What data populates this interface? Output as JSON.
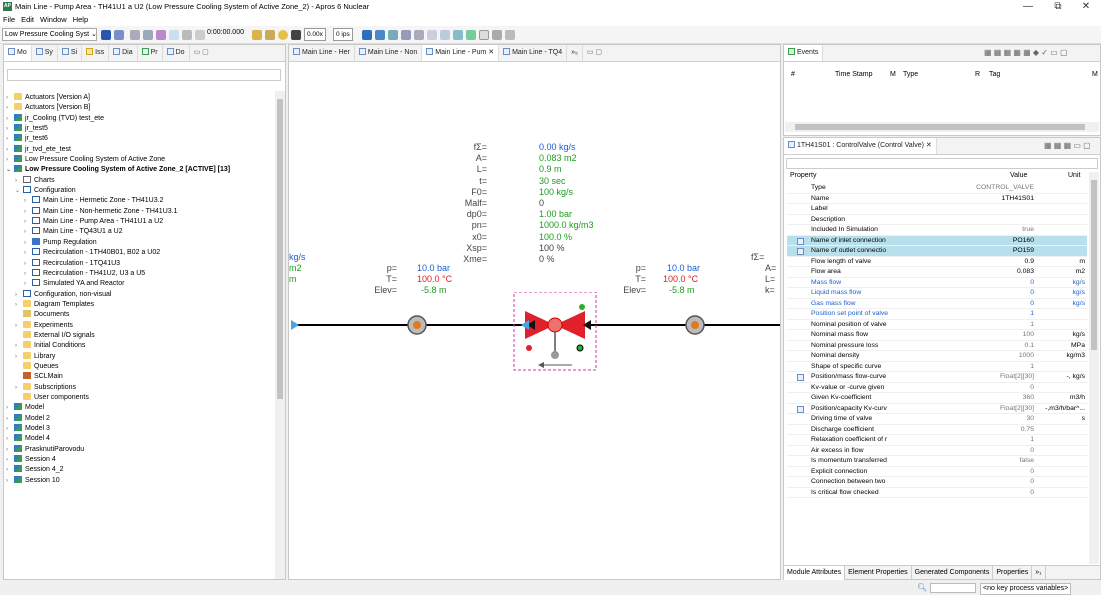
{
  "window": {
    "title": "Main Line - Pump Area - TH41U1 a U2 (Low Pressure Cooling System of Active Zone_2) - Apros 6 Nuclear",
    "icon": "apros-app-icon",
    "minimize": "—",
    "maximize": "⧉",
    "close": "✕"
  },
  "menu": [
    "File",
    "Edit",
    "Window",
    "Help"
  ],
  "toolbar": {
    "model_combo": "Low Pressure Cooling Syst",
    "sim_time": "0:00:00.000",
    "speed": "0.00x",
    "ips": "0 ips"
  },
  "left_tabs": [
    "Mo",
    "Sy",
    "Si",
    "Iss",
    "Dia",
    "Pr",
    "Do"
  ],
  "tree": [
    {
      "label": "Actuators [Version A]",
      "icon": "folder",
      "depth": 0,
      "arrow": "›"
    },
    {
      "label": "Actuators [Version B]",
      "icon": "folder",
      "depth": 0,
      "arrow": "›"
    },
    {
      "label": "jr_Cooling (TVD) test_ete",
      "icon": "proj",
      "depth": 0,
      "arrow": "›"
    },
    {
      "label": "jr_test5",
      "icon": "proj",
      "depth": 0,
      "arrow": "›"
    },
    {
      "label": "jr_test6",
      "icon": "proj",
      "depth": 0,
      "arrow": "›"
    },
    {
      "label": "jr_tvd_ete_test",
      "icon": "proj",
      "depth": 0,
      "arrow": "›"
    },
    {
      "label": "Low Pressure Cooling System of Active Zone",
      "icon": "proj",
      "depth": 0,
      "arrow": "›"
    },
    {
      "label": "Low Pressure Cooling System of Active Zone_2 [ACTIVE] [13]",
      "icon": "proj",
      "depth": 0,
      "arrow": "⌄",
      "bold": true
    },
    {
      "label": "Charts",
      "icon": "chart",
      "depth": 1,
      "arrow": "›"
    },
    {
      "label": "Configuration",
      "icon": "diag",
      "depth": 1,
      "arrow": "⌄"
    },
    {
      "label": "Main Line - Hermetic Zone - TH41U3.2",
      "icon": "diag",
      "depth": 2,
      "arrow": "›"
    },
    {
      "label": "Main Line - Non-hermetic Zone - TH41U3.1",
      "icon": "diag",
      "depth": 2,
      "arrow": "›"
    },
    {
      "label": "Main Line - Pump Area - TH41U1 a U2",
      "icon": "diag",
      "depth": 2,
      "arrow": "›"
    },
    {
      "label": "Main Line - TQ43U1 a U2",
      "icon": "diag",
      "depth": 2,
      "arrow": "›"
    },
    {
      "label": "Pump Regulation",
      "icon": "pump",
      "depth": 2,
      "arrow": "›"
    },
    {
      "label": "Recirculation - 1TH40B01, B02 a U02",
      "icon": "diag",
      "depth": 2,
      "arrow": "›"
    },
    {
      "label": "Recirculation - 1TQ41U3",
      "icon": "diag",
      "depth": 2,
      "arrow": "›"
    },
    {
      "label": "Recirculation - TH41U2, U3 a U5",
      "icon": "diag",
      "depth": 2,
      "arrow": "›"
    },
    {
      "label": "Simulated YA and Reactor",
      "icon": "diag",
      "depth": 2,
      "arrow": "›"
    },
    {
      "label": "Configuration, non-visual",
      "icon": "diag",
      "depth": 1,
      "arrow": "›"
    },
    {
      "label": "Diagram Templates",
      "icon": "folder",
      "depth": 1,
      "arrow": "›"
    },
    {
      "label": "Documents",
      "icon": "doc",
      "depth": 1,
      "arrow": ""
    },
    {
      "label": "Experiments",
      "icon": "folder",
      "depth": 1,
      "arrow": "›"
    },
    {
      "label": "External I/O signals",
      "icon": "folder",
      "depth": 1,
      "arrow": ""
    },
    {
      "label": "Initial Conditions",
      "icon": "folder",
      "depth": 1,
      "arrow": "›"
    },
    {
      "label": "Library",
      "icon": "folder",
      "depth": 1,
      "arrow": "›"
    },
    {
      "label": "Queues",
      "icon": "folder",
      "depth": 1,
      "arrow": ""
    },
    {
      "label": "SCLMain",
      "icon": "scl",
      "depth": 1,
      "arrow": ""
    },
    {
      "label": "Subscriptions",
      "icon": "folder",
      "depth": 1,
      "arrow": "›"
    },
    {
      "label": "User components",
      "icon": "folder",
      "depth": 1,
      "arrow": ""
    },
    {
      "label": "Model",
      "icon": "proj",
      "depth": 0,
      "arrow": "›"
    },
    {
      "label": "Model 2",
      "icon": "proj",
      "depth": 0,
      "arrow": "›"
    },
    {
      "label": "Model 3",
      "icon": "proj",
      "depth": 0,
      "arrow": "›"
    },
    {
      "label": "Model 4",
      "icon": "proj",
      "depth": 0,
      "arrow": "›"
    },
    {
      "label": "PrasknutiParovodu",
      "icon": "proj",
      "depth": 0,
      "arrow": "›"
    },
    {
      "label": "Session 4",
      "icon": "proj",
      "depth": 0,
      "arrow": "›"
    },
    {
      "label": "Session 4_2",
      "icon": "proj",
      "depth": 0,
      "arrow": "›"
    },
    {
      "label": "Session 10",
      "icon": "proj",
      "depth": 0,
      "arrow": "›"
    }
  ],
  "editor_tabs": [
    "Main Line - Her",
    "Main Line - Non",
    "Main Line - Pum",
    "Main Line - TQ4"
  ],
  "editor_overflow": "»₅",
  "diagram": {
    "valve_params": [
      {
        "k": "fΣ=",
        "v": "0.00 kg/s"
      },
      {
        "k": "A=",
        "v": "0.083 m2"
      },
      {
        "k": "L=",
        "v": "0.9 m"
      },
      {
        "k": "t=",
        "v": "30 sec"
      },
      {
        "k": "F0=",
        "v": "100 kg/s"
      },
      {
        "k": "Malf=",
        "v": "0"
      },
      {
        "k": "dp0=",
        "v": "1.00 bar"
      },
      {
        "k": "pn=",
        "v": "1000.0 kg/m3"
      },
      {
        "k": "x0=",
        "v": "100.0 %"
      },
      {
        "k": "Xsp=",
        "v": "100 %"
      },
      {
        "k": "Xme=",
        "v": "0 %"
      }
    ],
    "left_node": {
      "p_k": "p=",
      "p_v": "10.0 bar",
      "t_k": "T=",
      "t_v": "100.0 °C",
      "e_k": "Elev=",
      "e_v": "-5.8 m"
    },
    "right_node": {
      "p_k": "p=",
      "p_v": "10.0 bar",
      "t_k": "T=",
      "t_v": "100.0 °C",
      "e_k": "Elev=",
      "e_v": "-5.8 m"
    },
    "cut_left": [
      "kg/s",
      "m2",
      "m"
    ],
    "cut_right": [
      "fΣ=",
      "A=",
      "L=",
      "k="
    ]
  },
  "events": {
    "tab": "Events",
    "cols": [
      "#",
      "Time Stamp",
      "M",
      "Type",
      "R",
      "Tag",
      "M"
    ]
  },
  "props": {
    "tab": "1TH41S01 : ControlValve (Control Valve)",
    "head": {
      "p": "Property",
      "v": "Value",
      "u": "Unit"
    },
    "rows": [
      {
        "n": "Type",
        "v": "CONTROL_VALVE",
        "u": ""
      },
      {
        "n": "Name",
        "v": "1TH41S01",
        "u": "",
        "dark": true
      },
      {
        "n": "Label",
        "v": "",
        "u": ""
      },
      {
        "n": "Description",
        "v": "",
        "u": ""
      },
      {
        "n": "Included In Simulation",
        "v": "true",
        "u": ""
      },
      {
        "n": "Name of inlet connection",
        "v": "PO160",
        "u": "",
        "hl": true
      },
      {
        "n": "Name of outlet connectio",
        "v": "PO159",
        "u": "",
        "hl": true
      },
      {
        "n": "Flow length of valve",
        "v": "0.9",
        "u": "m",
        "dark": true
      },
      {
        "n": "Flow area",
        "v": "0.083",
        "u": "m2",
        "dark": true
      },
      {
        "n": "Mass flow",
        "v": "0",
        "u": "kg/s",
        "blue": true
      },
      {
        "n": "Liquid mass flow",
        "v": "0",
        "u": "kg/s",
        "blue": true
      },
      {
        "n": "Gas mass flow",
        "v": "0",
        "u": "kg/s",
        "blue": true
      },
      {
        "n": "Position set point of valve",
        "v": "1",
        "u": "",
        "blue": true
      },
      {
        "n": "Nominal position of valve",
        "v": "1",
        "u": ""
      },
      {
        "n": "Nominal mass flow",
        "v": "100",
        "u": "kg/s"
      },
      {
        "n": "Nominal pressure loss",
        "v": "0.1",
        "u": "MPa"
      },
      {
        "n": "Nominal density",
        "v": "1000",
        "u": "kg/m3"
      },
      {
        "n": "Shape of specific curve",
        "v": "1",
        "u": ""
      },
      {
        "n": "Position/mass flow-curve",
        "v": "Float[2][30]",
        "u": "-, kg/s",
        "grid": true
      },
      {
        "n": "Kv-value or -curve given",
        "v": "0",
        "u": ""
      },
      {
        "n": "Given Kv-coefficient",
        "v": "360",
        "u": "m3/h"
      },
      {
        "n": "Position/capacity Kv-curv",
        "v": "Float[2][30]",
        "u": "-,m3/h/bar^...",
        "grid": true
      },
      {
        "n": "Driving time of valve",
        "v": "30",
        "u": "s"
      },
      {
        "n": "Discharge coefficient",
        "v": "0.75",
        "u": ""
      },
      {
        "n": "Relaxation coefficient of r",
        "v": "1",
        "u": ""
      },
      {
        "n": "Air excess in flow",
        "v": "0",
        "u": ""
      },
      {
        "n": "Is momentum transferred",
        "v": "false",
        "u": ""
      },
      {
        "n": "Explicit connection",
        "v": "0",
        "u": ""
      },
      {
        "n": "Connection between two",
        "v": "0",
        "u": ""
      },
      {
        "n": "Is critical flow checked",
        "v": "0",
        "u": ""
      }
    ],
    "bottom_tabs": [
      "Module Attributes",
      "Element Properties",
      "Generated Components",
      "Properties",
      "»₁"
    ]
  },
  "status": {
    "text": "<no key process variables>"
  }
}
